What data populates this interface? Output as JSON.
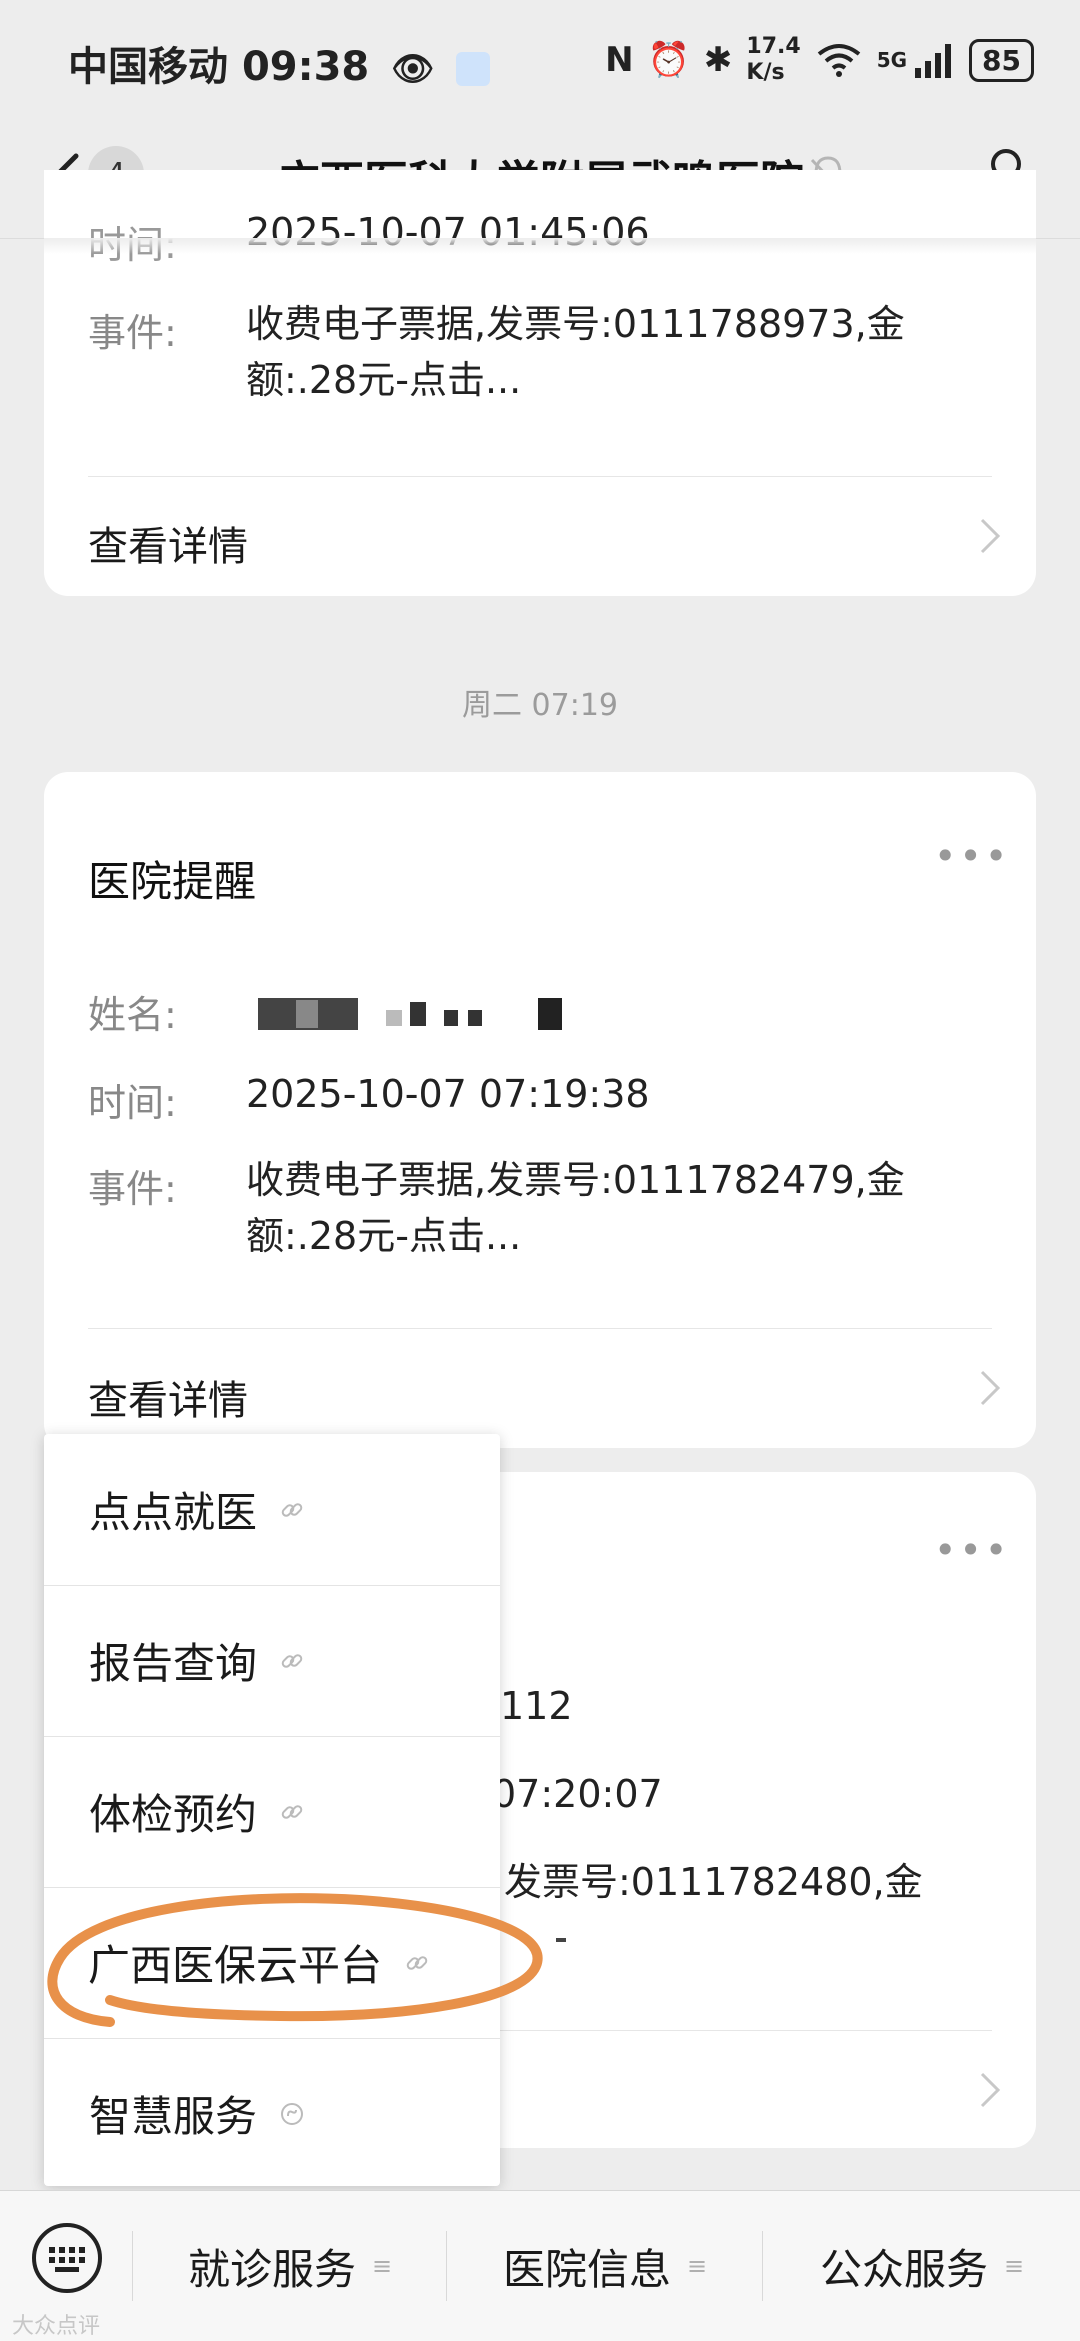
{
  "status_bar": {
    "carrier": "中国移动",
    "time": "09:38",
    "net_speed_value": "17.4",
    "net_speed_unit": "K/s",
    "network": "5G",
    "battery": "85"
  },
  "header": {
    "back_count": "4",
    "title": "广西医科大学附属武鸣医院"
  },
  "card1": {
    "time_label": "时间:",
    "time_value": "2025-10-07 01:45:06",
    "event_label": "事件:",
    "event_line1": "收费电子票据,发票号:0111788973,金",
    "event_line2": "额:.28元-点击...",
    "details": "查看详情"
  },
  "timestamp": "周二 07:19",
  "card2": {
    "title": "医院提醒",
    "name_label": "姓名:",
    "time_label": "时间:",
    "time_value": "2025-10-07 07:19:38",
    "event_label": "事件:",
    "event_line1": "收费电子票据,发票号:0111782479,金",
    "event_line2": "额:.28元-点击...",
    "details": "查看详情"
  },
  "card3": {
    "frag_name": "112",
    "frag_time": "07:20:07",
    "frag_event": "发票号:0111782480,金"
  },
  "menu": {
    "items": [
      {
        "label": "点点就医"
      },
      {
        "label": "报告查询"
      },
      {
        "label": "体检预约"
      },
      {
        "label": "广西医保云平台"
      },
      {
        "label": "智慧服务"
      }
    ],
    "highlight_color": "#e8914a"
  },
  "bottom_bar": {
    "tabs": [
      {
        "label": "就诊服务"
      },
      {
        "label": "医院信息"
      },
      {
        "label": "公众服务"
      }
    ]
  },
  "watermark": "大众点评"
}
